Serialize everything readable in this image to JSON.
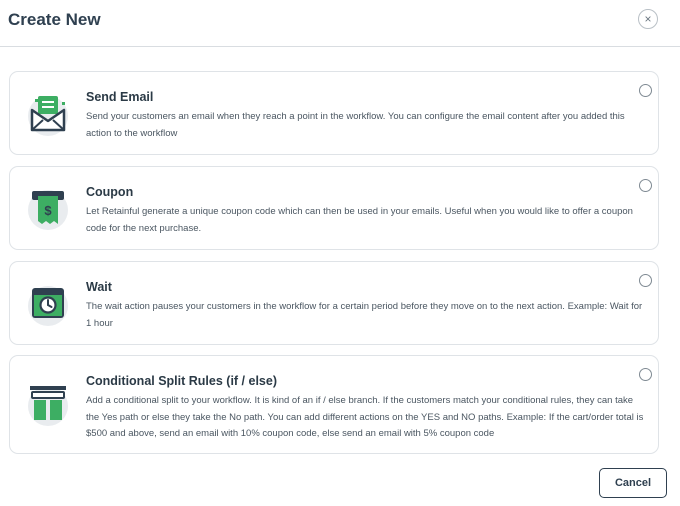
{
  "dialog": {
    "title": "Create New",
    "close_symbol": "×",
    "cancel_label": "Cancel"
  },
  "options": [
    {
      "icon": "envelope-icon",
      "title": "Send Email",
      "description": "Send your customers an email when they reach a point in the workflow. You can configure the email content after you added this action to the workflow"
    },
    {
      "icon": "coupon-receipt-icon",
      "title": "Coupon",
      "description": "Let Retainful generate a unique coupon code which can then be used in your emails. Useful when you would like to offer a coupon code for the next purchase."
    },
    {
      "icon": "clock-window-icon",
      "title": "Wait",
      "description": "The wait action pauses your customers in the workflow for a certain period before they move on to the next action. Example: Wait for 1 hour"
    },
    {
      "icon": "split-columns-icon",
      "title": "Conditional Split Rules (if / else)",
      "description": "Add a conditional split to your workflow. It is kind of an if / else branch. If the customers match your conditional rules, they can take the Yes path or else they take the No path. You can add different actions on the YES and NO paths. Example: If the cart/order total is $500 and above, send an email with 10% coupon code, else send an email with 5% coupon code"
    }
  ],
  "colors": {
    "icon_dark": "#2f4050",
    "icon_green": "#3dae63",
    "icon_bg": "#e9ecef"
  }
}
